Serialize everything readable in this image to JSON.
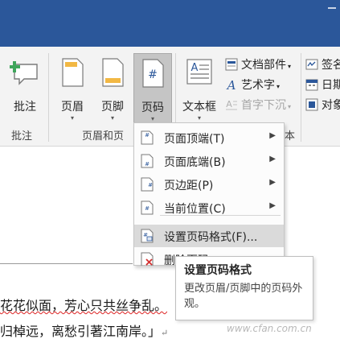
{
  "ribbon": {
    "comment_button": "批注",
    "comment_group": "批注",
    "header_button": "页眉",
    "footer_button": "页脚",
    "page_number_button": "页码",
    "header_footer_group": "页眉和页",
    "textbox_button": "文本框",
    "quick_parts": "文档部件",
    "wordart": "艺术字",
    "dropcap": "首字下沉",
    "signature": "签名",
    "datetime": "日期",
    "object": "对象",
    "text_group_tail": "本"
  },
  "menu": {
    "items": [
      {
        "label": "页面顶端(T)",
        "icon": "page-top-icon",
        "submenu": true
      },
      {
        "label": "页面底端(B)",
        "icon": "page-bottom-icon",
        "submenu": true
      },
      {
        "label": "页边距(P)",
        "icon": "page-margin-icon",
        "submenu": true
      },
      {
        "label": "当前位置(C)",
        "icon": "current-position-icon",
        "submenu": true
      },
      {
        "label": "设置页码格式(F)...",
        "icon": "format-page-number-icon",
        "submenu": false
      },
      {
        "label": "删除页码",
        "icon": "remove-page-number-icon",
        "submenu": false
      }
    ]
  },
  "tooltip": {
    "title": "设置页码格式",
    "body": "更改页眉/页脚中的页码外观。"
  },
  "document": {
    "line1": "花花似面，芳心只共丝争乱。",
    "line2": "归棹远，离愁引著江南岸。」"
  },
  "watermark": "www.cfan.com.cn",
  "colors": {
    "title_bar": "#2b579a",
    "ribbon_bg": "#f3f3f3",
    "active_button": "#c5c5c5",
    "menu_hover": "#dadada"
  }
}
